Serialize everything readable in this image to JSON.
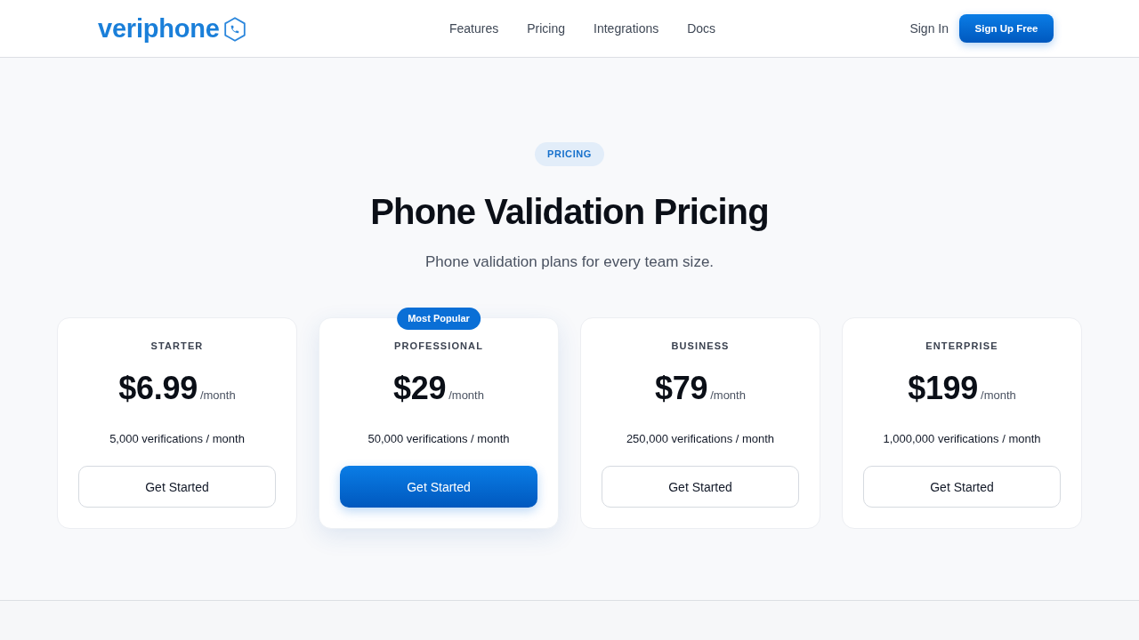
{
  "header": {
    "logo": {
      "text": "veriphone"
    },
    "nav_links": [
      "Features",
      "Pricing",
      "Integrations",
      "Docs"
    ],
    "sign_in": "Sign In",
    "cta": "Sign Up Free"
  },
  "hero": {
    "eyebrow": "PRICING",
    "title": "Phone Validation Pricing",
    "subtitle": "Phone validation plans for every team size."
  },
  "plans": [
    {
      "name": "STARTER",
      "price": "$6.99",
      "period": "/month",
      "quota": "5,000 verifications / month",
      "button": "Get Started",
      "featured": false
    },
    {
      "name": "PROFESSIONAL",
      "price": "$29",
      "period": "/month",
      "quota": "50,000 verifications / month",
      "button": "Get Started",
      "featured": true,
      "badge": "Most Popular"
    },
    {
      "name": "BUSINESS",
      "price": "$79",
      "period": "/month",
      "quota": "250,000 verifications / month",
      "button": "Get Started",
      "featured": false
    },
    {
      "name": "ENTERPRISE",
      "price": "$199",
      "period": "/month",
      "quota": "1,000,000 verifications / month",
      "button": "Get Started",
      "featured": false
    }
  ]
}
